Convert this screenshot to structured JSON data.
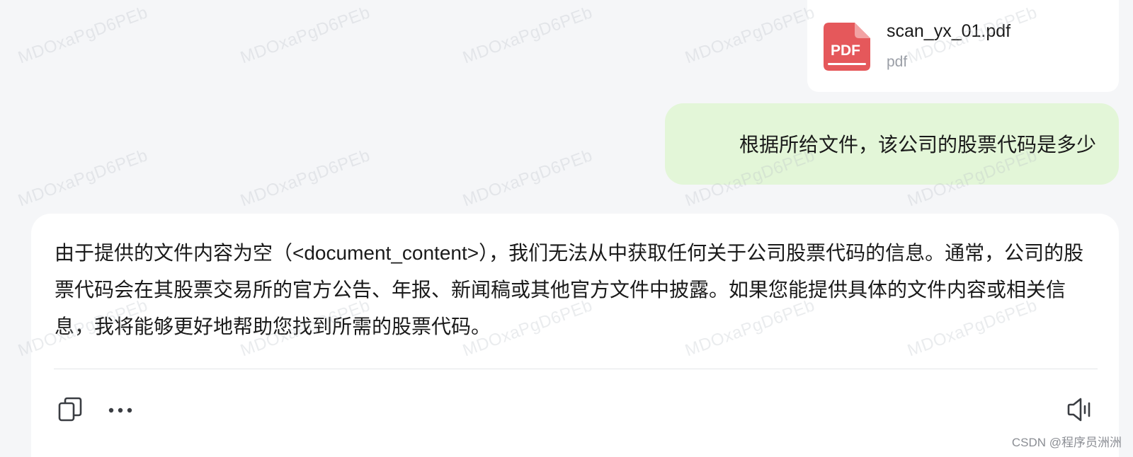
{
  "watermark": {
    "text": "MDOxaPgD6PEb"
  },
  "attachment": {
    "icon": "pdf-file-icon",
    "icon_label": "PDF",
    "icon_color": "#e5585b",
    "file_name": "scan_yx_01.pdf",
    "file_type": "pdf"
  },
  "user_message": {
    "text": "根据所给文件，该公司的股票代码是多少",
    "bubble_color": "#e3f6d8"
  },
  "assistant_message": {
    "text": "由于提供的文件内容为空（<document_content>），我们无法从中获取任何关于公司股票代码的信息。通常，公司的股票代码会在其股票交易所的官方公告、年报、新闻稿或其他官方文件中披露。如果您能提供具体的文件内容或相关信息，我将能够更好地帮助您找到所需的股票代码。",
    "actions": {
      "copy_icon": "copy-icon",
      "more_icon": "more-icon",
      "read_aloud_icon": "speaker-icon"
    }
  },
  "footer": {
    "credit": "CSDN @程序员洲洲"
  }
}
